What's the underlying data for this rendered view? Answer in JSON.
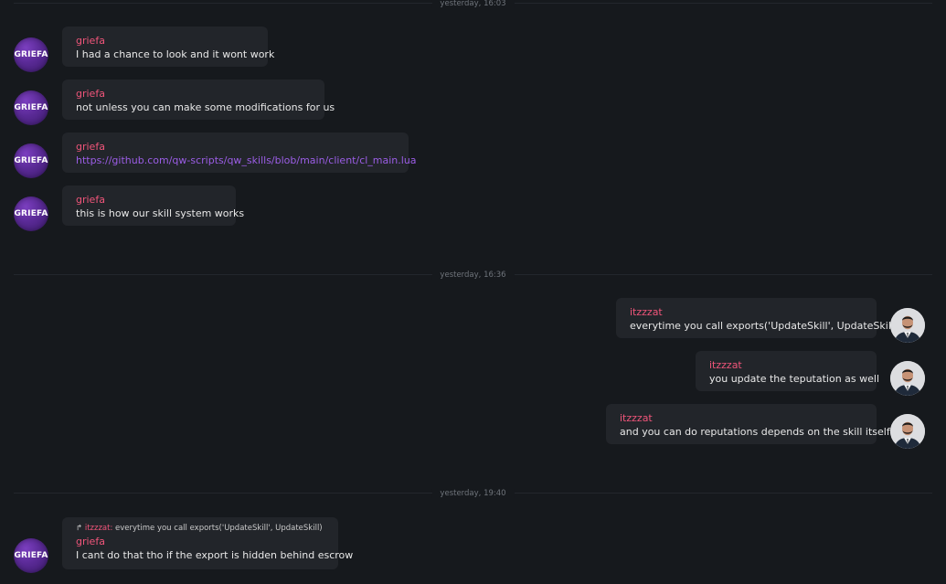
{
  "dividers": [
    {
      "label": "yesterday, 16:03"
    },
    {
      "label": "yesterday, 16:36"
    },
    {
      "label": "yesterday, 19:40"
    }
  ],
  "messages": [
    {
      "author": "griefa",
      "text": "I had a chance to look and it wont work"
    },
    {
      "author": "griefa",
      "text": "not unless you can make some modifications for us"
    },
    {
      "author": "griefa",
      "text": "https://github.com/qw-scripts/qw_skills/blob/main/client/cl_main.lua"
    },
    {
      "author": "griefa",
      "text": "this is how our skill system works"
    },
    {
      "author": "itzzzat",
      "text": "everytime you call exports('UpdateSkill', UpdateSkill)"
    },
    {
      "author": "itzzzat",
      "text": "you update the teputation as well"
    },
    {
      "author": "itzzzat",
      "text": "and you can do reputations depends on the skill itself"
    },
    {
      "author": "griefa",
      "text": "I cant do that tho if the export is hidden behind escrow",
      "reply": {
        "arrow": "↱",
        "author": "itzzzat:",
        "text": "everytime you call exports('UpdateSkill', UpdateSkill)"
      }
    }
  ],
  "avatars": {
    "griefa_label": "GRIEFA"
  },
  "colors": {
    "background": "#16191d",
    "bubble": "#22252a",
    "author": "#f0557a",
    "link": "#9b5de5",
    "avatar_purple": "#5a2a96"
  }
}
